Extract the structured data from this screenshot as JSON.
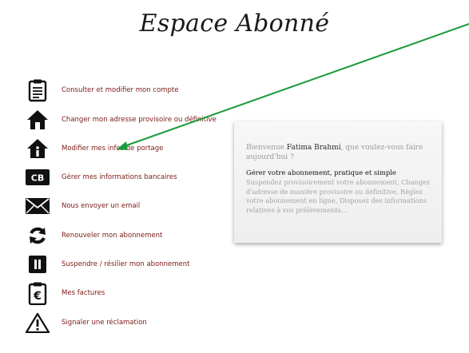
{
  "page": {
    "title": "Espace Abonné"
  },
  "menu": {
    "items": [
      {
        "label": "Consulter et modifier mon compte",
        "icon": "clipboard-account-icon"
      },
      {
        "label": "Changer mon adresse provisoire ou définitive",
        "icon": "house-icon"
      },
      {
        "label": "Modifier mes infos de portage",
        "icon": "house-info-icon"
      },
      {
        "label": "Gérer mes informations bancaires",
        "icon": "bank-card-icon"
      },
      {
        "label": "Nous envoyer un email",
        "icon": "envelope-icon"
      },
      {
        "label": "Renouveler mon abonnement",
        "icon": "refresh-icon"
      },
      {
        "label": "Suspendre / résilier mon abonnement",
        "icon": "pause-icon"
      },
      {
        "label": "Mes factures",
        "icon": "euro-invoice-icon"
      },
      {
        "label": "Signaler une réclamation",
        "icon": "warning-icon"
      }
    ]
  },
  "welcome": {
    "greeting_prefix": "Bienvenue",
    "user_name": "Fatima Brahmi",
    "greeting_suffix": ", que voulez-vous faire aujourd'hui ?",
    "subtitle": "Gérer votre abonnement, pratique et simple",
    "description": "Suspendez provisoirement votre abonnement, Changez d'adresse de manière provisoire ou définitive, Réglez votre abonnement en ligne, Disposez des informations relatives à vos prélèvements..."
  },
  "colors": {
    "link": "#7a1a14",
    "arrow": "#1a9a3a",
    "icon": "#111111"
  }
}
